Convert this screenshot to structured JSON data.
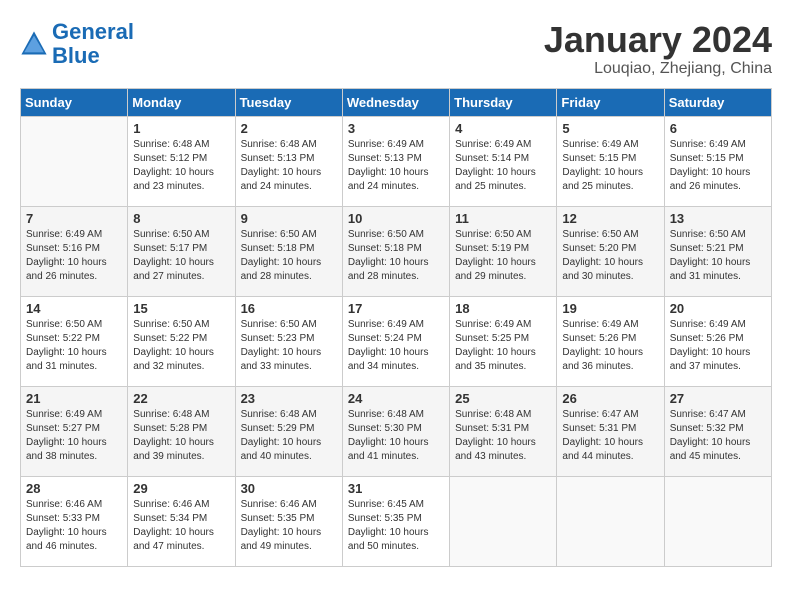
{
  "header": {
    "logo_line1": "General",
    "logo_line2": "Blue",
    "month_title": "January 2024",
    "location": "Louqiao, Zhejiang, China"
  },
  "days_of_week": [
    "Sunday",
    "Monday",
    "Tuesday",
    "Wednesday",
    "Thursday",
    "Friday",
    "Saturday"
  ],
  "weeks": [
    [
      {
        "day": "",
        "sunrise": "",
        "sunset": "",
        "daylight": "",
        "empty": true
      },
      {
        "day": "1",
        "sunrise": "Sunrise: 6:48 AM",
        "sunset": "Sunset: 5:12 PM",
        "daylight": "Daylight: 10 hours and 23 minutes."
      },
      {
        "day": "2",
        "sunrise": "Sunrise: 6:48 AM",
        "sunset": "Sunset: 5:13 PM",
        "daylight": "Daylight: 10 hours and 24 minutes."
      },
      {
        "day": "3",
        "sunrise": "Sunrise: 6:49 AM",
        "sunset": "Sunset: 5:13 PM",
        "daylight": "Daylight: 10 hours and 24 minutes."
      },
      {
        "day": "4",
        "sunrise": "Sunrise: 6:49 AM",
        "sunset": "Sunset: 5:14 PM",
        "daylight": "Daylight: 10 hours and 25 minutes."
      },
      {
        "day": "5",
        "sunrise": "Sunrise: 6:49 AM",
        "sunset": "Sunset: 5:15 PM",
        "daylight": "Daylight: 10 hours and 25 minutes."
      },
      {
        "day": "6",
        "sunrise": "Sunrise: 6:49 AM",
        "sunset": "Sunset: 5:15 PM",
        "daylight": "Daylight: 10 hours and 26 minutes."
      }
    ],
    [
      {
        "day": "7",
        "sunrise": "Sunrise: 6:49 AM",
        "sunset": "Sunset: 5:16 PM",
        "daylight": "Daylight: 10 hours and 26 minutes."
      },
      {
        "day": "8",
        "sunrise": "Sunrise: 6:50 AM",
        "sunset": "Sunset: 5:17 PM",
        "daylight": "Daylight: 10 hours and 27 minutes."
      },
      {
        "day": "9",
        "sunrise": "Sunrise: 6:50 AM",
        "sunset": "Sunset: 5:18 PM",
        "daylight": "Daylight: 10 hours and 28 minutes."
      },
      {
        "day": "10",
        "sunrise": "Sunrise: 6:50 AM",
        "sunset": "Sunset: 5:18 PM",
        "daylight": "Daylight: 10 hours and 28 minutes."
      },
      {
        "day": "11",
        "sunrise": "Sunrise: 6:50 AM",
        "sunset": "Sunset: 5:19 PM",
        "daylight": "Daylight: 10 hours and 29 minutes."
      },
      {
        "day": "12",
        "sunrise": "Sunrise: 6:50 AM",
        "sunset": "Sunset: 5:20 PM",
        "daylight": "Daylight: 10 hours and 30 minutes."
      },
      {
        "day": "13",
        "sunrise": "Sunrise: 6:50 AM",
        "sunset": "Sunset: 5:21 PM",
        "daylight": "Daylight: 10 hours and 31 minutes."
      }
    ],
    [
      {
        "day": "14",
        "sunrise": "Sunrise: 6:50 AM",
        "sunset": "Sunset: 5:22 PM",
        "daylight": "Daylight: 10 hours and 31 minutes."
      },
      {
        "day": "15",
        "sunrise": "Sunrise: 6:50 AM",
        "sunset": "Sunset: 5:22 PM",
        "daylight": "Daylight: 10 hours and 32 minutes."
      },
      {
        "day": "16",
        "sunrise": "Sunrise: 6:50 AM",
        "sunset": "Sunset: 5:23 PM",
        "daylight": "Daylight: 10 hours and 33 minutes."
      },
      {
        "day": "17",
        "sunrise": "Sunrise: 6:49 AM",
        "sunset": "Sunset: 5:24 PM",
        "daylight": "Daylight: 10 hours and 34 minutes."
      },
      {
        "day": "18",
        "sunrise": "Sunrise: 6:49 AM",
        "sunset": "Sunset: 5:25 PM",
        "daylight": "Daylight: 10 hours and 35 minutes."
      },
      {
        "day": "19",
        "sunrise": "Sunrise: 6:49 AM",
        "sunset": "Sunset: 5:26 PM",
        "daylight": "Daylight: 10 hours and 36 minutes."
      },
      {
        "day": "20",
        "sunrise": "Sunrise: 6:49 AM",
        "sunset": "Sunset: 5:26 PM",
        "daylight": "Daylight: 10 hours and 37 minutes."
      }
    ],
    [
      {
        "day": "21",
        "sunrise": "Sunrise: 6:49 AM",
        "sunset": "Sunset: 5:27 PM",
        "daylight": "Daylight: 10 hours and 38 minutes."
      },
      {
        "day": "22",
        "sunrise": "Sunrise: 6:48 AM",
        "sunset": "Sunset: 5:28 PM",
        "daylight": "Daylight: 10 hours and 39 minutes."
      },
      {
        "day": "23",
        "sunrise": "Sunrise: 6:48 AM",
        "sunset": "Sunset: 5:29 PM",
        "daylight": "Daylight: 10 hours and 40 minutes."
      },
      {
        "day": "24",
        "sunrise": "Sunrise: 6:48 AM",
        "sunset": "Sunset: 5:30 PM",
        "daylight": "Daylight: 10 hours and 41 minutes."
      },
      {
        "day": "25",
        "sunrise": "Sunrise: 6:48 AM",
        "sunset": "Sunset: 5:31 PM",
        "daylight": "Daylight: 10 hours and 43 minutes."
      },
      {
        "day": "26",
        "sunrise": "Sunrise: 6:47 AM",
        "sunset": "Sunset: 5:31 PM",
        "daylight": "Daylight: 10 hours and 44 minutes."
      },
      {
        "day": "27",
        "sunrise": "Sunrise: 6:47 AM",
        "sunset": "Sunset: 5:32 PM",
        "daylight": "Daylight: 10 hours and 45 minutes."
      }
    ],
    [
      {
        "day": "28",
        "sunrise": "Sunrise: 6:46 AM",
        "sunset": "Sunset: 5:33 PM",
        "daylight": "Daylight: 10 hours and 46 minutes."
      },
      {
        "day": "29",
        "sunrise": "Sunrise: 6:46 AM",
        "sunset": "Sunset: 5:34 PM",
        "daylight": "Daylight: 10 hours and 47 minutes."
      },
      {
        "day": "30",
        "sunrise": "Sunrise: 6:46 AM",
        "sunset": "Sunset: 5:35 PM",
        "daylight": "Daylight: 10 hours and 49 minutes."
      },
      {
        "day": "31",
        "sunrise": "Sunrise: 6:45 AM",
        "sunset": "Sunset: 5:35 PM",
        "daylight": "Daylight: 10 hours and 50 minutes."
      },
      {
        "day": "",
        "sunrise": "",
        "sunset": "",
        "daylight": "",
        "empty": true
      },
      {
        "day": "",
        "sunrise": "",
        "sunset": "",
        "daylight": "",
        "empty": true
      },
      {
        "day": "",
        "sunrise": "",
        "sunset": "",
        "daylight": "",
        "empty": true
      }
    ]
  ]
}
